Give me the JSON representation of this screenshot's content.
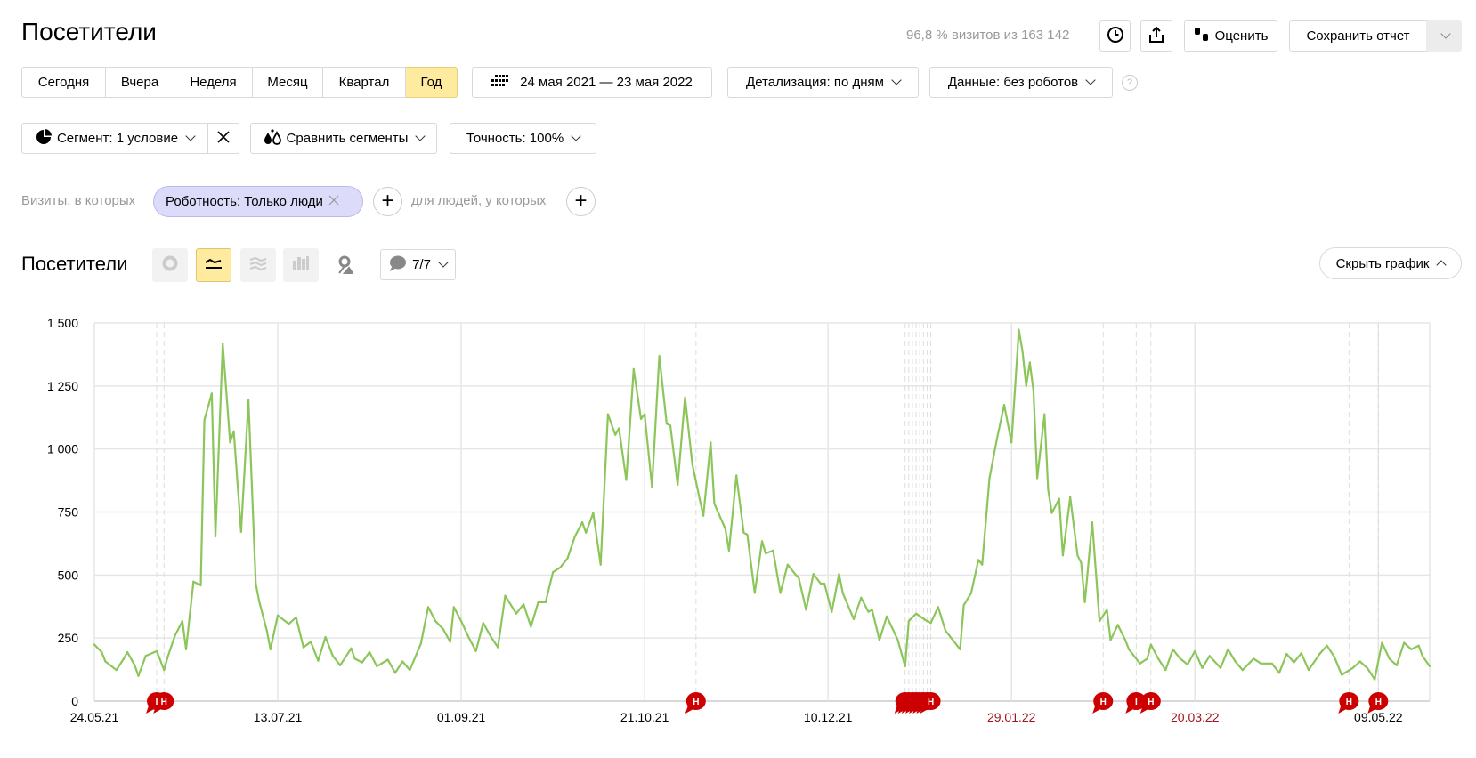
{
  "header": {
    "title": "Посетители",
    "sampling_info": "96,8 % визитов из 163 142",
    "rate_label": "Оценить",
    "save_label": "Сохранить отчет",
    "history_icon": "clock-icon",
    "export_icon": "upload-icon"
  },
  "periods": [
    {
      "label": "Сегодня",
      "active": false
    },
    {
      "label": "Вчера",
      "active": false
    },
    {
      "label": "Неделя",
      "active": false
    },
    {
      "label": "Месяц",
      "active": false
    },
    {
      "label": "Квартал",
      "active": false
    },
    {
      "label": "Год",
      "active": true
    }
  ],
  "date_range": "24 мая 2021 — 23 мая 2022",
  "detail_select": "Детализация: по дням",
  "data_select": "Данные: без роботов",
  "help_icon": "?",
  "segment": {
    "segment_label": "Сегмент: 1 условие",
    "compare_label": "Сравнить сегменты",
    "accuracy_label": "Точность: 100%"
  },
  "filter": {
    "prefix": "Визиты, в которых",
    "chip": "Роботность: Только люди",
    "people_text": "для людей, у которых"
  },
  "chart_header": {
    "title": "Посетители",
    "notes_count": "7/7",
    "hide_label": "Скрыть график",
    "active_view": "line"
  },
  "colors": {
    "line": "#8cc65a",
    "active": "#ffeba0",
    "marker": "#cc0000",
    "weekend_label": "#a0151b",
    "chip": "#dcdcfa"
  },
  "chart_data": {
    "type": "line",
    "ylim": [
      0,
      1500
    ],
    "y_ticks": [
      "0",
      "250",
      "500",
      "750",
      "1 000",
      "1 250",
      "1 500"
    ],
    "y_tick_values": [
      0,
      250,
      500,
      750,
      1000,
      1250,
      1500
    ],
    "x_range": [
      "2021-05-24",
      "2022-05-23"
    ],
    "x_ticks": [
      {
        "label": "24.05.21",
        "date": "2021-05-24",
        "weekend": false
      },
      {
        "label": "13.07.21",
        "date": "2021-07-13",
        "weekend": false
      },
      {
        "label": "01.09.21",
        "date": "2021-09-01",
        "weekend": false
      },
      {
        "label": "21.10.21",
        "date": "2021-10-21",
        "weekend": false
      },
      {
        "label": "10.12.21",
        "date": "2021-12-10",
        "weekend": false
      },
      {
        "label": "29.01.22",
        "date": "2022-01-29",
        "weekend": true
      },
      {
        "label": "20.03.22",
        "date": "2022-03-20",
        "weekend": true
      },
      {
        "label": "09.05.22",
        "date": "2022-05-09",
        "weekend": false
      }
    ],
    "grid": true,
    "series": [
      {
        "points": [
          [
            "2021-05-24",
            224
          ],
          [
            "2021-05-26",
            194
          ],
          [
            "2021-05-27",
            157
          ],
          [
            "2021-05-30",
            123
          ],
          [
            "2021-06-01",
            168
          ],
          [
            "2021-06-02",
            194
          ],
          [
            "2021-06-04",
            142
          ],
          [
            "2021-06-05",
            100
          ],
          [
            "2021-06-07",
            179
          ],
          [
            "2021-06-10",
            198
          ],
          [
            "2021-06-12",
            123
          ],
          [
            "2021-06-13",
            175
          ],
          [
            "2021-06-15",
            261
          ],
          [
            "2021-06-17",
            317
          ],
          [
            "2021-06-18",
            205
          ],
          [
            "2021-06-20",
            474
          ],
          [
            "2021-06-22",
            459
          ],
          [
            "2021-06-23",
            1115
          ],
          [
            "2021-06-25",
            1220
          ],
          [
            "2021-06-26",
            653
          ],
          [
            "2021-06-28",
            1417
          ],
          [
            "2021-06-30",
            1026
          ],
          [
            "2021-07-01",
            1070
          ],
          [
            "2021-07-03",
            671
          ],
          [
            "2021-07-05",
            1194
          ],
          [
            "2021-07-07",
            466
          ],
          [
            "2021-07-08",
            392
          ],
          [
            "2021-07-10",
            280
          ],
          [
            "2021-07-11",
            205
          ],
          [
            "2021-07-13",
            340
          ],
          [
            "2021-07-16",
            306
          ],
          [
            "2021-07-18",
            332
          ],
          [
            "2021-07-20",
            213
          ],
          [
            "2021-07-22",
            235
          ],
          [
            "2021-07-24",
            160
          ],
          [
            "2021-07-26",
            254
          ],
          [
            "2021-07-28",
            179
          ],
          [
            "2021-07-30",
            142
          ],
          [
            "2021-08-02",
            209
          ],
          [
            "2021-08-03",
            168
          ],
          [
            "2021-08-05",
            153
          ],
          [
            "2021-08-07",
            194
          ],
          [
            "2021-08-09",
            138
          ],
          [
            "2021-08-12",
            164
          ],
          [
            "2021-08-14",
            112
          ],
          [
            "2021-08-16",
            157
          ],
          [
            "2021-08-18",
            123
          ],
          [
            "2021-08-21",
            228
          ],
          [
            "2021-08-23",
            373
          ],
          [
            "2021-08-25",
            317
          ],
          [
            "2021-08-27",
            287
          ],
          [
            "2021-08-29",
            235
          ],
          [
            "2021-08-30",
            373
          ],
          [
            "2021-09-01",
            317
          ],
          [
            "2021-09-03",
            254
          ],
          [
            "2021-09-05",
            198
          ],
          [
            "2021-09-07",
            310
          ],
          [
            "2021-09-09",
            257
          ],
          [
            "2021-09-11",
            213
          ],
          [
            "2021-09-13",
            418
          ],
          [
            "2021-09-16",
            347
          ],
          [
            "2021-09-18",
            384
          ],
          [
            "2021-09-20",
            295
          ],
          [
            "2021-09-22",
            392
          ],
          [
            "2021-09-24",
            392
          ],
          [
            "2021-09-26",
            511
          ],
          [
            "2021-09-28",
            530
          ],
          [
            "2021-09-30",
            567
          ],
          [
            "2021-10-02",
            653
          ],
          [
            "2021-10-04",
            709
          ],
          [
            "2021-10-05",
            668
          ],
          [
            "2021-10-07",
            746
          ],
          [
            "2021-10-09",
            541
          ],
          [
            "2021-10-11",
            1138
          ],
          [
            "2021-10-13",
            1056
          ],
          [
            "2021-10-14",
            1082
          ],
          [
            "2021-10-16",
            877
          ],
          [
            "2021-10-18",
            1317
          ],
          [
            "2021-10-20",
            1119
          ],
          [
            "2021-10-21",
            1138
          ],
          [
            "2021-10-23",
            850
          ],
          [
            "2021-10-25",
            1369
          ],
          [
            "2021-10-27",
            1100
          ],
          [
            "2021-10-28",
            1093
          ],
          [
            "2021-10-30",
            858
          ],
          [
            "2021-11-01",
            1205
          ],
          [
            "2021-11-03",
            940
          ],
          [
            "2021-11-05",
            802
          ],
          [
            "2021-11-06",
            735
          ],
          [
            "2021-11-08",
            1026
          ],
          [
            "2021-11-09",
            783
          ],
          [
            "2021-11-12",
            683
          ],
          [
            "2021-11-13",
            597
          ],
          [
            "2021-11-15",
            895
          ],
          [
            "2021-11-17",
            668
          ],
          [
            "2021-11-18",
            660
          ],
          [
            "2021-11-20",
            429
          ],
          [
            "2021-11-22",
            634
          ],
          [
            "2021-11-23",
            586
          ],
          [
            "2021-11-25",
            597
          ],
          [
            "2021-11-27",
            429
          ],
          [
            "2021-11-29",
            541
          ],
          [
            "2021-12-01",
            504
          ],
          [
            "2021-12-02",
            489
          ],
          [
            "2021-12-04",
            362
          ],
          [
            "2021-12-06",
            504
          ],
          [
            "2021-12-08",
            466
          ],
          [
            "2021-12-09",
            466
          ],
          [
            "2021-12-11",
            354
          ],
          [
            "2021-12-13",
            504
          ],
          [
            "2021-12-14",
            429
          ],
          [
            "2021-12-17",
            325
          ],
          [
            "2021-12-19",
            410
          ],
          [
            "2021-12-21",
            354
          ],
          [
            "2021-12-22",
            362
          ],
          [
            "2021-12-24",
            242
          ],
          [
            "2021-12-26",
            336
          ],
          [
            "2021-12-29",
            242
          ],
          [
            "2021-12-31",
            138
          ],
          [
            "2022-01-01",
            317
          ],
          [
            "2022-01-03",
            347
          ],
          [
            "2022-01-06",
            317
          ],
          [
            "2022-01-07",
            310
          ],
          [
            "2022-01-09",
            373
          ],
          [
            "2022-01-11",
            280
          ],
          [
            "2022-01-13",
            242
          ],
          [
            "2022-01-15",
            205
          ],
          [
            "2022-01-16",
            380
          ],
          [
            "2022-01-18",
            429
          ],
          [
            "2022-01-20",
            560
          ],
          [
            "2022-01-21",
            541
          ],
          [
            "2022-01-23",
            884
          ],
          [
            "2022-01-25",
            1037
          ],
          [
            "2022-01-27",
            1175
          ],
          [
            "2022-01-29",
            1026
          ],
          [
            "2022-01-31",
            1473
          ],
          [
            "2022-02-01",
            1387
          ],
          [
            "2022-02-02",
            1250
          ],
          [
            "2022-02-03",
            1343
          ],
          [
            "2022-02-04",
            1231
          ],
          [
            "2022-02-05",
            884
          ],
          [
            "2022-02-07",
            1138
          ],
          [
            "2022-02-08",
            839
          ],
          [
            "2022-02-09",
            746
          ],
          [
            "2022-02-11",
            802
          ],
          [
            "2022-02-12",
            578
          ],
          [
            "2022-02-14",
            809
          ],
          [
            "2022-02-16",
            578
          ],
          [
            "2022-02-17",
            548
          ],
          [
            "2022-02-18",
            392
          ],
          [
            "2022-02-20",
            709
          ],
          [
            "2022-02-22",
            317
          ],
          [
            "2022-02-24",
            362
          ],
          [
            "2022-02-25",
            242
          ],
          [
            "2022-02-27",
            302
          ],
          [
            "2022-03-01",
            242
          ],
          [
            "2022-03-02",
            205
          ],
          [
            "2022-03-05",
            149
          ],
          [
            "2022-03-07",
            168
          ],
          [
            "2022-03-08",
            224
          ],
          [
            "2022-03-10",
            168
          ],
          [
            "2022-03-12",
            123
          ],
          [
            "2022-03-14",
            205
          ],
          [
            "2022-03-16",
            168
          ],
          [
            "2022-03-18",
            145
          ],
          [
            "2022-03-20",
            198
          ],
          [
            "2022-03-22",
            131
          ],
          [
            "2022-03-24",
            179
          ],
          [
            "2022-03-27",
            131
          ],
          [
            "2022-03-29",
            205
          ],
          [
            "2022-03-31",
            157
          ],
          [
            "2022-04-02",
            123
          ],
          [
            "2022-04-05",
            168
          ],
          [
            "2022-04-07",
            149
          ],
          [
            "2022-04-10",
            149
          ],
          [
            "2022-04-12",
            112
          ],
          [
            "2022-04-14",
            187
          ],
          [
            "2022-04-16",
            153
          ],
          [
            "2022-04-18",
            190
          ],
          [
            "2022-04-20",
            123
          ],
          [
            "2022-04-23",
            187
          ],
          [
            "2022-04-25",
            220
          ],
          [
            "2022-04-27",
            175
          ],
          [
            "2022-04-29",
            104
          ],
          [
            "2022-05-02",
            131
          ],
          [
            "2022-05-04",
            157
          ],
          [
            "2022-05-06",
            131
          ],
          [
            "2022-05-08",
            86
          ],
          [
            "2022-05-10",
            231
          ],
          [
            "2022-05-12",
            168
          ],
          [
            "2022-05-14",
            142
          ],
          [
            "2022-05-16",
            231
          ],
          [
            "2022-05-18",
            205
          ],
          [
            "2022-05-20",
            220
          ],
          [
            "2022-05-21",
            179
          ],
          [
            "2022-05-23",
            138
          ]
        ]
      }
    ],
    "annotations": [
      {
        "date": "2021-06-10",
        "label": "I"
      },
      {
        "date": "2021-06-12",
        "label": "Н"
      },
      {
        "date": "2021-11-04",
        "label": "Н"
      },
      {
        "date": "2021-12-31",
        "label": ""
      },
      {
        "date": "2022-01-01",
        "label": ""
      },
      {
        "date": "2022-01-02",
        "label": ""
      },
      {
        "date": "2022-01-03",
        "label": ""
      },
      {
        "date": "2022-01-04",
        "label": ""
      },
      {
        "date": "2022-01-05",
        "label": ""
      },
      {
        "date": "2022-01-06",
        "label": ""
      },
      {
        "date": "2022-01-07",
        "label": "Н"
      },
      {
        "date": "2022-02-23",
        "label": "Н"
      },
      {
        "date": "2022-03-04",
        "label": "I"
      },
      {
        "date": "2022-03-08",
        "label": "Н"
      },
      {
        "date": "2022-05-01",
        "label": "Н"
      },
      {
        "date": "2022-05-09",
        "label": "Н"
      }
    ]
  }
}
